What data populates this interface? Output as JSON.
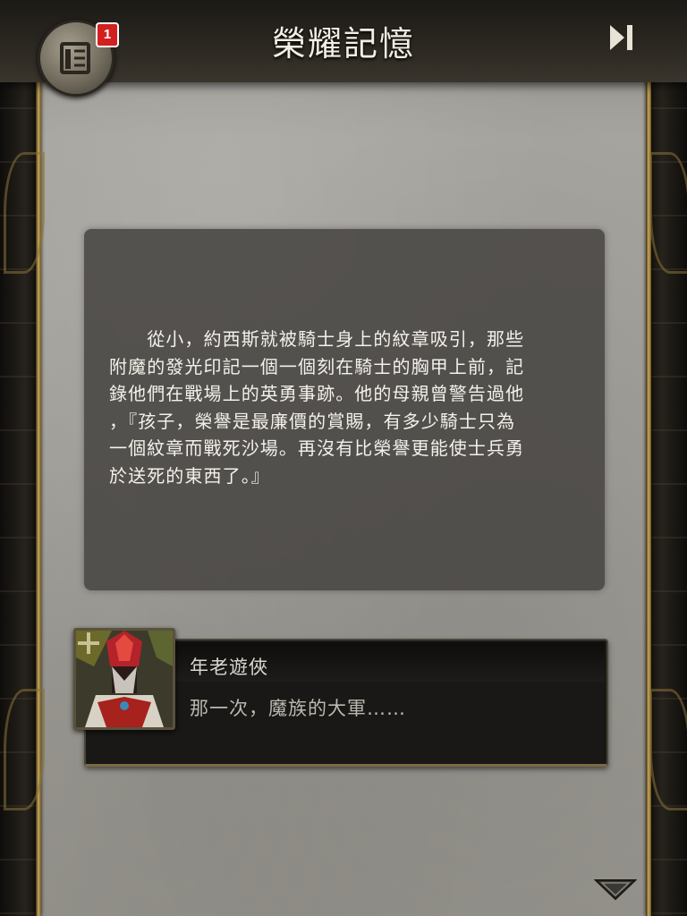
{
  "header": {
    "title": "榮耀記憶",
    "menu_badge_count": "1",
    "menu_icon": "scroll-icon",
    "skip_icon": "skip-forward-icon"
  },
  "story": {
    "text": "　　從小，約西斯就被騎士身上的紋章吸引，那些\n附魔的發光印記一個一個刻在騎士的胸甲上前，記\n錄他們在戰場上的英勇事跡。他的母親曾警告過他\n，『孩子，榮譽是最廉價的賞賜，有多少騎士只為\n一個紋章而戰死沙場。再沒有比榮譽更能使士兵勇\n於送死的東西了。』"
  },
  "dialog": {
    "speaker": "年老遊俠",
    "line": "那一次，魔族的大軍……",
    "portrait_icon": "ranger-portrait-icon"
  },
  "footer": {
    "next_icon": "down-triangle-icon"
  },
  "colors": {
    "badge": "#d21f1f",
    "gold_trim": "#c9a85a",
    "parchment": "#a3a19b"
  }
}
